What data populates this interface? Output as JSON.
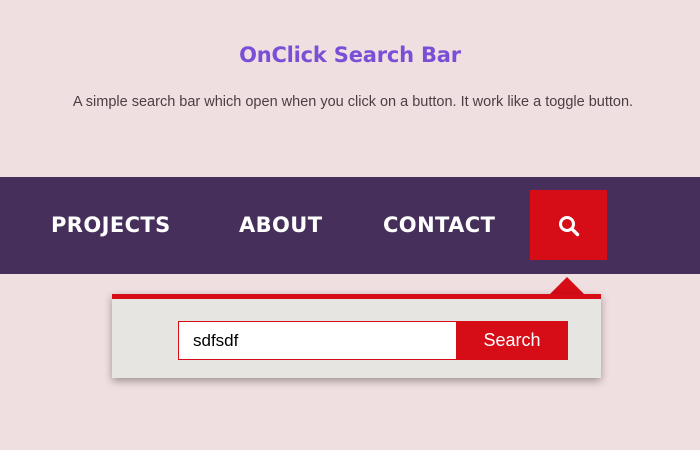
{
  "header": {
    "title": "OnClick Search Bar",
    "subtitle": "A simple search bar which open when you click on a button. It work like a toggle button."
  },
  "nav": {
    "items": [
      {
        "label": "PROJECTS"
      },
      {
        "label": "ABOUT"
      },
      {
        "label": "CONTACT"
      }
    ],
    "search_toggle_icon": "search-icon"
  },
  "search_panel": {
    "input_value": "sdfsdf",
    "button_label": "Search"
  },
  "colors": {
    "background": "#f0dfe0",
    "title": "#7a4fd6",
    "navbar": "#46305b",
    "accent": "#d60c16",
    "panel": "#e6e5e1"
  }
}
